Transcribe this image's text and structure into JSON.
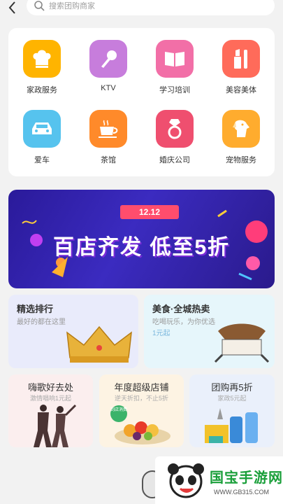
{
  "search": {
    "placeholder": "搜索团购商家"
  },
  "categories": [
    {
      "label": "家政服务",
      "icon": "chef-hat-icon",
      "color": "#ffb400"
    },
    {
      "label": "KTV",
      "icon": "microphone-icon",
      "color": "#c77ddc"
    },
    {
      "label": "学习培训",
      "icon": "book-icon",
      "color": "#f26fa7"
    },
    {
      "label": "美容美体",
      "icon": "lipstick-icon",
      "color": "#ff6b5a"
    },
    {
      "label": "爱车",
      "icon": "car-icon",
      "color": "#56c3ee"
    },
    {
      "label": "茶馆",
      "icon": "tea-cup-icon",
      "color": "#ff8a2a"
    },
    {
      "label": "婚庆公司",
      "icon": "ring-icon",
      "color": "#ef4f6f"
    },
    {
      "label": "宠物服务",
      "icon": "dog-icon",
      "color": "#ffac2e"
    }
  ],
  "banner": {
    "tag": "12.12",
    "title": "百店齐发 低至5折"
  },
  "promo": {
    "left": {
      "title": "精选排行",
      "subtitle": "最好的都在这里"
    },
    "right": {
      "title": "美食·全城热卖",
      "subtitle": "吃喝玩乐，为你优选",
      "price": "1元起"
    }
  },
  "bottom": [
    {
      "title": "嗨歌好去处",
      "subtitle": "激情唱响1元起"
    },
    {
      "title": "年度超级店铺",
      "subtitle": "逆天折扣，不止5折",
      "badge": "到店消费"
    },
    {
      "title": "团购再5折",
      "subtitle": "家政5元起"
    }
  ],
  "watermark": {
    "name": "国宝手游网",
    "url": "WWW.GB315.COM"
  }
}
